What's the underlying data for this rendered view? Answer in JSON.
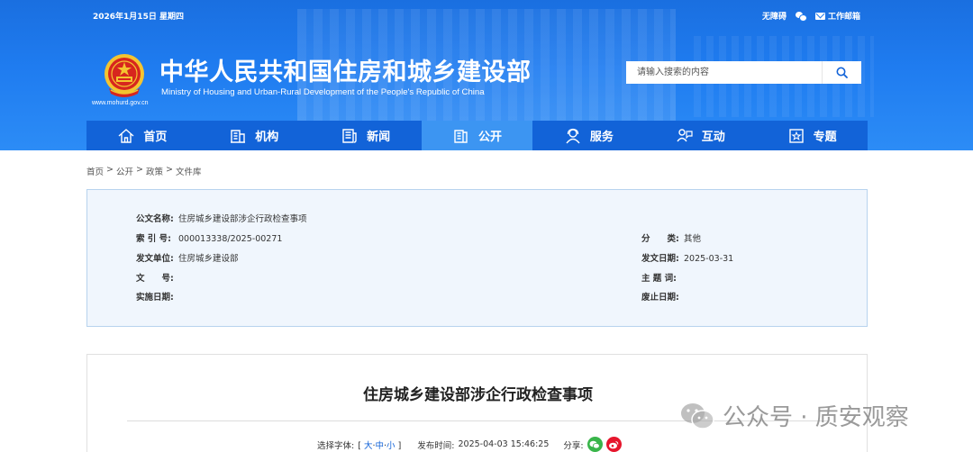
{
  "header": {
    "date": "2026年1月15日 星期四",
    "links": [
      {
        "label": "无障碍",
        "icon": "accessibility-icon"
      },
      {
        "label": "",
        "icon": "wechat-icon"
      },
      {
        "label": "工作邮箱",
        "icon": "mail-icon"
      }
    ],
    "site_url": "www.mohurd.gov.cn",
    "title": "中华人民共和国住房和城乡建设部",
    "subtitle": "Ministry of Housing and Urban-Rural Development of the People's Republic of China",
    "search": {
      "placeholder": "请输入搜索的内容"
    },
    "colors": {
      "header_blue": "#1f7cf0",
      "nav_blue": "#1263d8",
      "nav_active": "#3c95f2"
    }
  },
  "nav": [
    {
      "label": "首页",
      "icon": "home-icon"
    },
    {
      "label": "机构",
      "icon": "building-icon"
    },
    {
      "label": "新闻",
      "icon": "newspaper-icon"
    },
    {
      "label": "公开",
      "icon": "document-icon",
      "active": true
    },
    {
      "label": "服务",
      "icon": "service-icon"
    },
    {
      "label": "互动",
      "icon": "interaction-icon"
    },
    {
      "label": "专题",
      "icon": "topic-icon"
    }
  ],
  "breadcrumb": [
    "首页",
    "公开",
    "政策",
    "文件库"
  ],
  "meta": {
    "doc_name_label": "公文名称:",
    "doc_name": "住房城乡建设部涉企行政检查事项",
    "index_label": "索 引 号:",
    "index": "000013338/2025-00271",
    "issuer_label": "发文单位:",
    "issuer": "住房城乡建设部",
    "doc_no_label": "文　　号:",
    "doc_no": "",
    "effective_label": "实施日期:",
    "effective": "",
    "category_label": "分　　类:",
    "category": "其他",
    "issue_date_label": "发文日期:",
    "issue_date": "2025-03-31",
    "subject_label": "主 题 词:",
    "subject": "",
    "repeal_label": "废止日期:",
    "repeal": ""
  },
  "article": {
    "title": "住房城乡建设部涉企行政检查事项",
    "font_select_label": "选择字体:",
    "font_sizes": [
      "大",
      "中",
      "小"
    ],
    "publish_label": "发布时间:",
    "publish_time": "2025-04-03 15:46:25",
    "share_label": "分享:"
  },
  "watermark": {
    "text": "公众号 · 质安观察"
  }
}
